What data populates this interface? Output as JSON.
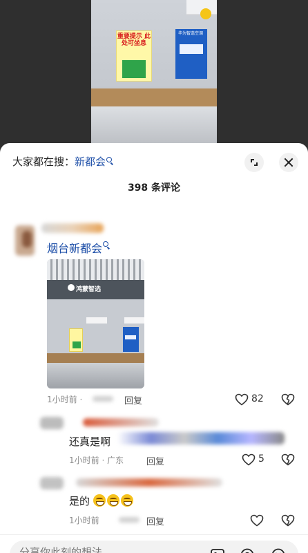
{
  "sheet": {
    "hot_search_prefix": "大家都在搜：",
    "hot_search_keyword": "新都会",
    "comment_count": "398 条评论"
  },
  "video": {
    "poster_yellow_title": "重要提示 此处可坐息",
    "poster_blue_title": "华为智选空调"
  },
  "comments": [
    {
      "text": "烟台新都会",
      "has_search_link": true,
      "image_brand": "鸿蒙智选",
      "time": "1小时前 ·",
      "reply_label": "回复",
      "likes": "82"
    }
  ],
  "replies": [
    {
      "text": "还真是啊",
      "time": "1小时前 · 广东",
      "reply_label": "回复",
      "likes": "5"
    },
    {
      "text": "是的",
      "time": "1小时前",
      "reply_label": "回复",
      "likes": ""
    }
  ],
  "input": {
    "placeholder": "分享你此刻的想法"
  },
  "icons": {
    "search": "search-icon",
    "expand": "expand-icon",
    "close": "close-icon",
    "heart": "heart-icon",
    "dislike": "dislike-icon",
    "image": "image-icon",
    "at": "at-icon",
    "emoji": "emoji-icon"
  },
  "colors": {
    "link": "#1e4fa8",
    "muted": "#8a8a8a"
  }
}
